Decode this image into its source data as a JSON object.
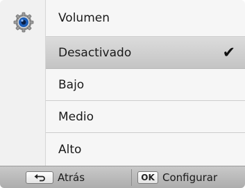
{
  "menu": {
    "header_title": "Volumen",
    "icon": "gear-icon",
    "items": [
      {
        "label": "Desactivado",
        "selected": true
      },
      {
        "label": "Bajo",
        "selected": false
      },
      {
        "label": "Medio",
        "selected": false
      },
      {
        "label": "Alto",
        "selected": false
      }
    ],
    "check_glyph": "✔"
  },
  "bottom_bar": {
    "back_key_icon": "back-arrow-icon",
    "back_label": "Atrás",
    "ok_key_label": "OK",
    "ok_label": "Configurar"
  },
  "colors": {
    "selected_row": "#c8c8c8",
    "icon_blue": "#1e5fb8"
  }
}
